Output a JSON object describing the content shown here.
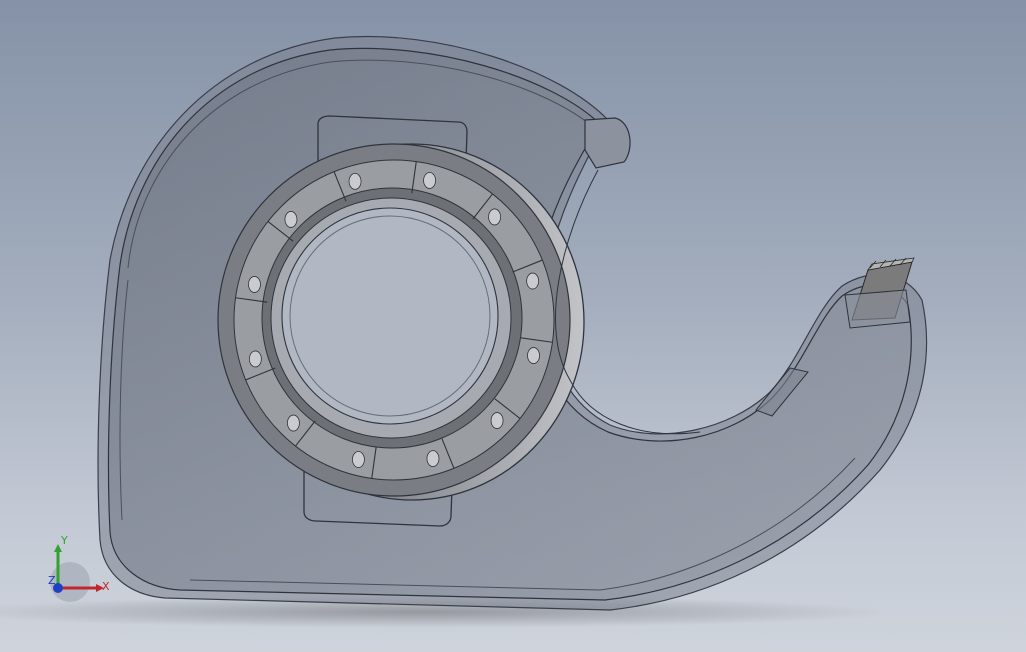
{
  "viewport": {
    "model": "tape-dispenser",
    "colors": {
      "background_top": "#8592a7",
      "background_bottom": "#ced3dc",
      "body_fill": "#808896",
      "edge": "#3a3f48",
      "ring_dark": "#6a6d73",
      "ring_light": "#b8bbc0"
    }
  },
  "triad": {
    "x_label": "X",
    "y_label": "Y",
    "z_label": "Z",
    "x_color": "#c0272d",
    "y_color": "#2ea32e",
    "z_color": "#1f3fc4"
  }
}
